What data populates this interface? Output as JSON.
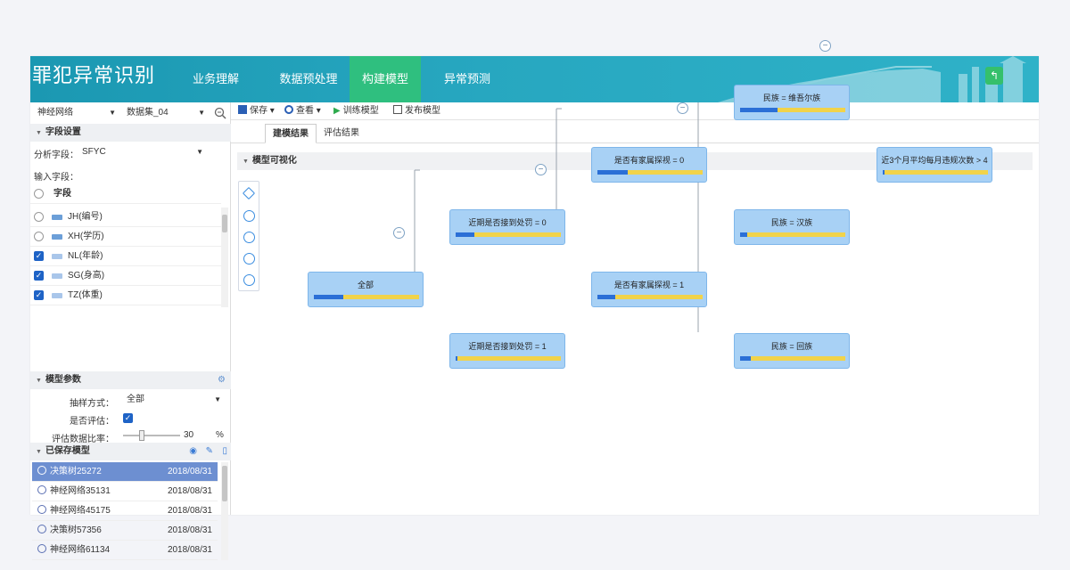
{
  "header": {
    "title": "罪犯异常识别",
    "tabs": [
      {
        "label": "业务理解",
        "active": false
      },
      {
        "label": "数据预处理",
        "active": false
      },
      {
        "label": "构建模型",
        "active": true
      },
      {
        "label": "异常预测",
        "active": false
      }
    ]
  },
  "left": {
    "algo_select": "神经网络",
    "dataset_select": "数据集_04",
    "field_section": "字段设置",
    "target_label": "分析字段：",
    "target_value": "SFYC",
    "input_label": "输入字段：",
    "field_col_header": "字段",
    "fields": [
      {
        "label": "JH(编号)",
        "checked": false
      },
      {
        "label": "XH(学历)",
        "checked": false
      },
      {
        "label": "NL(年龄)",
        "checked": true
      },
      {
        "label": "SG(身高)",
        "checked": true
      },
      {
        "label": "TZ(体重)",
        "checked": true
      }
    ],
    "param_section": "模型参数",
    "param_rows": [
      {
        "label": "抽样方式：",
        "value": "全部"
      },
      {
        "label": "是否评估：",
        "value": ""
      },
      {
        "label": "评估数据比率：",
        "value": "30",
        "unit": "%"
      }
    ],
    "saved_section": "已保存模型",
    "models": [
      {
        "name": "决策树25272",
        "date": "2018/08/31",
        "selected": true
      },
      {
        "name": "神经网络35131",
        "date": "2018/08/31",
        "selected": false
      },
      {
        "name": "神经网络45175",
        "date": "2018/08/31",
        "selected": false
      },
      {
        "name": "决策树57356",
        "date": "2018/08/31",
        "selected": false
      },
      {
        "name": "神经网络61134",
        "date": "2018/08/31",
        "selected": false
      }
    ]
  },
  "toolbar": {
    "save": "保存",
    "view": "查看",
    "train": "训练模型",
    "publish": "发布模型"
  },
  "subtabs": [
    {
      "label": "建模结果",
      "active": true
    },
    {
      "label": "评估结果",
      "active": false
    }
  ],
  "viz": {
    "title": "模型可视化",
    "nodes": [
      {
        "id": "n0",
        "label": "全部",
        "fill": 0.28
      },
      {
        "id": "n1",
        "label": "近期是否接到处罚 = 0",
        "fill": 0.18
      },
      {
        "id": "n2",
        "label": "近期是否接到处罚 = 1",
        "fill": 0.02
      },
      {
        "id": "n3",
        "label": "是否有家属探视 = 0",
        "fill": 0.29
      },
      {
        "id": "n4",
        "label": "是否有家属探视 = 1",
        "fill": 0.17
      },
      {
        "id": "n5",
        "label": "民族 = 维吾尔族",
        "fill": 0.36
      },
      {
        "id": "n6",
        "label": "民族 = 汉族",
        "fill": 0.07
      },
      {
        "id": "n7",
        "label": "民族 = 回族",
        "fill": 0.1
      },
      {
        "id": "n8",
        "label": "近3个月平均每月违规次数 > 4",
        "fill": 0.02
      }
    ]
  },
  "colors": {
    "header": "#1b98b2",
    "active_tab": "#2fbf7f",
    "node": "#a8d1f5",
    "bar_blue": "#2b6fd6",
    "bar_yellow": "#f1d34a"
  }
}
